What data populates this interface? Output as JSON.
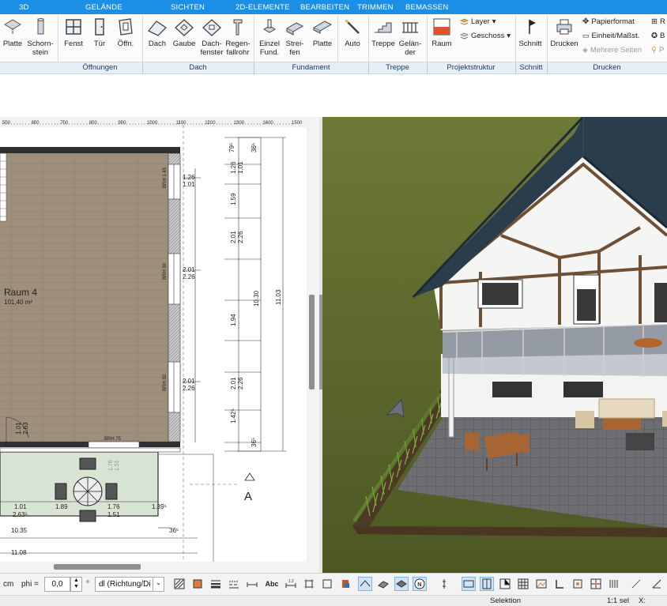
{
  "menu_tabs": [
    "3D",
    "GELÄNDE",
    "SICHTEN",
    "2D-ELEMENTE",
    "BEARBEITEN",
    "TRIMMEN",
    "BEMASSEN"
  ],
  "ribbon": {
    "buttons": {
      "platte1": [
        "Platte",
        ""
      ],
      "schornstein": [
        "Schorn-",
        "stein"
      ],
      "fenster": [
        "Fenst",
        ""
      ],
      "tuer": [
        "Tür",
        ""
      ],
      "oeffnung": [
        "Öffn.",
        ""
      ],
      "dach": [
        "Dach",
        ""
      ],
      "gaube": [
        "Gaube",
        ""
      ],
      "dachfenster": [
        "Dach-",
        "fenster"
      ],
      "regenfallrohr": [
        "Regen-",
        "fallrohr"
      ],
      "einzel": [
        "Einzel",
        "Fund."
      ],
      "streifen": [
        "Strei-",
        "fen"
      ],
      "platte2": [
        "Platte",
        ""
      ],
      "auto": [
        "Auto",
        ""
      ],
      "treppe": [
        "Treppe",
        ""
      ],
      "gelaender": [
        "Gelän-",
        "der"
      ],
      "raum": [
        "Raum",
        ""
      ],
      "schnitt": [
        "Schnitt",
        ""
      ],
      "drucken": [
        "Drucken",
        ""
      ]
    },
    "layer": "Layer",
    "geschoss": "Geschoss",
    "papierformat": "Papierformat",
    "einheit": "Einheit/Maßst.",
    "mehrere_seiten": "Mehrere Seiten",
    "cut_r": "R",
    "cut_b": "B",
    "cut_p": "P"
  },
  "groups": [
    "Öffnungen",
    "Dach",
    "Fundament",
    "Treppe",
    "Projektstruktur",
    "Schnitt",
    "Drucken"
  ],
  "plan": {
    "ruler_ticks": [
      "500",
      "600",
      "700",
      "800",
      "900",
      "1000",
      "1100",
      "1200",
      "1300",
      "1400",
      "1500"
    ],
    "room_name": "Raum 4",
    "room_area": "101,40 m²",
    "brh_labels": [
      "BRH 1.45",
      "BRH 30",
      "BRH 30",
      "BRH 75"
    ],
    "dims_right_a": [
      "1.26",
      "1.01",
      "2.01",
      "2.26",
      "2.01",
      "2.26"
    ],
    "dims_chain_rot": [
      "79⁵",
      "36⁵",
      "1.26",
      "1.01",
      "1.59",
      "2.01",
      "2.26",
      "1.94",
      "2.01",
      "2.26",
      "1.42⁵",
      "36⁵"
    ],
    "dims_total_rot": [
      "10.30",
      "11.03"
    ],
    "dims_left_rot": [
      "1.01",
      "2.63"
    ],
    "terrace_dims": [
      "1.01",
      "2.63⁵",
      "1.89",
      "1.76",
      "1.51",
      "1.39⁵",
      "1.76",
      "1.51"
    ],
    "bottom_dims": [
      "10.35",
      "36⁵",
      "11.08"
    ],
    "section_label": "A"
  },
  "bottombar": {
    "unit": "cm",
    "phi_label": "phi =",
    "phi_value": "0,0",
    "degree": "°",
    "dl_value": "dl (Richtung/Di"
  },
  "status": {
    "mode": "Selektion",
    "scale": "1:1 sel",
    "x_label": "X:"
  },
  "colors": {
    "accent": "#1b8fe6",
    "roof": "#2b3d4d",
    "grass": "#5f6b2c",
    "floor": "#9c8e7a",
    "terrace": "#d7e3d3"
  }
}
